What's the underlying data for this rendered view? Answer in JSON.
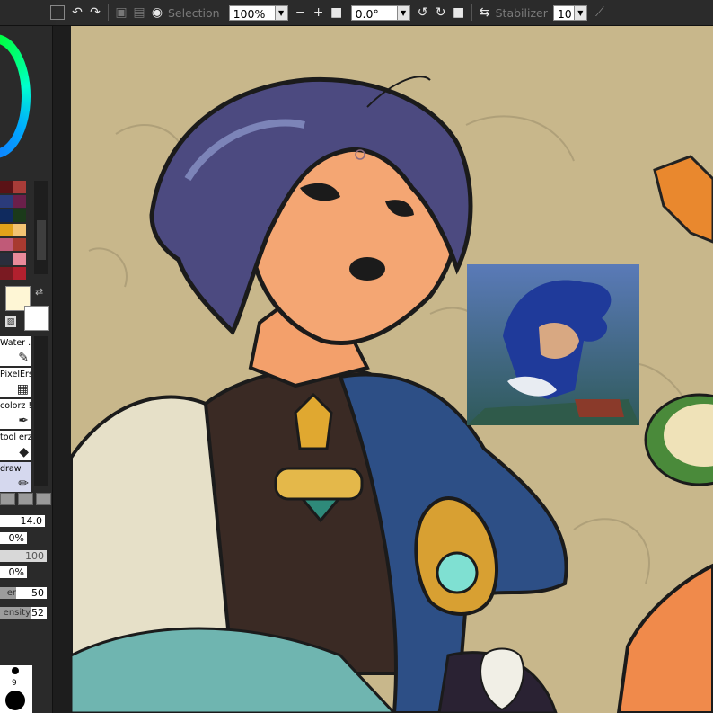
{
  "toolbar": {
    "selection_label": "Selection",
    "zoom_value": "100%",
    "rotation_value": "0.0°",
    "stabilizer_label": "Stabilizer",
    "stabilizer_value": "10"
  },
  "colors": {
    "foreground": "#fef6d5",
    "background": "#ffffff",
    "canvas": "#c8b78b",
    "panel": "#2a2a2a"
  },
  "palette": [
    [
      "#5a1216",
      "#a83c38"
    ],
    [
      "#2b3b7a",
      "#6b1f4a"
    ],
    [
      "#0f2a5e",
      "#1b3a1a"
    ],
    [
      "#e2a21a",
      "#f3c373"
    ],
    [
      "#c05a78",
      "#a83a30"
    ],
    [
      "#2a2e3c",
      "#e98a9a"
    ],
    [
      "#7a1a22",
      "#b2202e"
    ]
  ],
  "tools": [
    {
      "label": "Water ...",
      "icon": "brush-icon"
    },
    {
      "label": "PixelErs",
      "icon": "pixel-eraser-icon"
    },
    {
      "label": "colorz !",
      "icon": "pen-icon"
    },
    {
      "label": "tool erz",
      "icon": "eraser-icon"
    },
    {
      "label": "draw",
      "icon": "pencil-icon"
    }
  ],
  "brush_props": {
    "size": "14.0",
    "min_size": "0%",
    "density": "100",
    "min_density": "0%",
    "blending_label": "er",
    "blending": "50",
    "persistence_label": "ensity",
    "persistence": "52"
  },
  "brush_size_presets": [
    "9"
  ]
}
